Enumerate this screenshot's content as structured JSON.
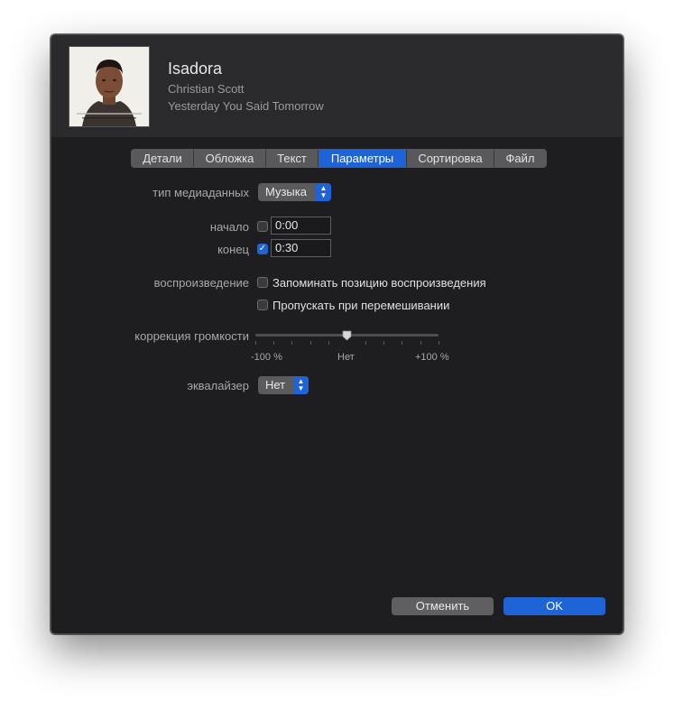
{
  "track": {
    "title": "Isadora",
    "artist": "Christian Scott",
    "album": "Yesterday You Said Tomorrow",
    "artwork_icon": "album-artwork"
  },
  "tabs": [
    {
      "label": "Детали",
      "active": false
    },
    {
      "label": "Обложка",
      "active": false
    },
    {
      "label": "Текст",
      "active": false
    },
    {
      "label": "Параметры",
      "active": true
    },
    {
      "label": "Сортировка",
      "active": false
    },
    {
      "label": "Файл",
      "active": false
    }
  ],
  "options": {
    "media_kind_label": "тип медиаданных",
    "media_kind_value": "Музыка",
    "start_label": "начало",
    "start_checked": false,
    "start_value": "0:00",
    "stop_label": "конец",
    "stop_checked": true,
    "stop_value": "0:30",
    "playback_label": "воспроизведение",
    "remember_position_label": "Запоминать позицию воспроизведения",
    "remember_position_checked": false,
    "skip_shuffle_label": "Пропускать при перемешивании",
    "skip_shuffle_checked": false,
    "volume_label": "коррекция громкости",
    "volume_min_label": "-100 %",
    "volume_mid_label": "Нет",
    "volume_max_label": "+100 %",
    "volume_value_percent": 0,
    "eq_label": "эквалайзер",
    "eq_value": "Нет"
  },
  "buttons": {
    "cancel": "Отменить",
    "ok": "OK"
  },
  "colors": {
    "accent": "#1f64d6",
    "window_bg": "#1e1e20",
    "header_bg": "#2a2a2c"
  }
}
